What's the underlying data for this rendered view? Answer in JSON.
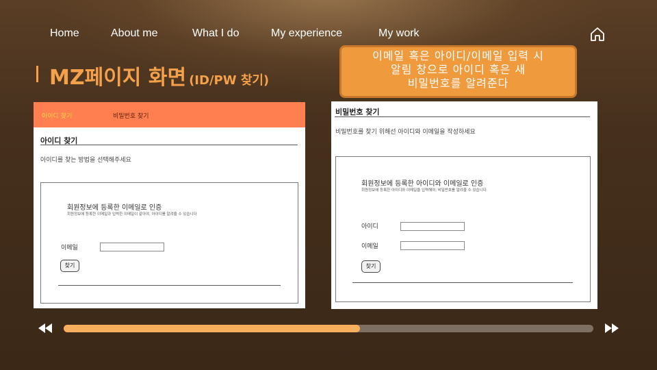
{
  "nav": {
    "items": [
      {
        "label": "Home"
      },
      {
        "label": "About me"
      },
      {
        "label": "What I do"
      },
      {
        "label": "My experience"
      },
      {
        "label": "My work"
      }
    ],
    "home_icon": "home-icon"
  },
  "title": {
    "main": "MZ페이지 화면",
    "sub": "(ID/PW 찾기)"
  },
  "callout": {
    "lines": [
      "이메일 혹은 아이디/이메일 입력 시",
      "알림 창으로 아이디 혹은 새",
      "비밀번호를 알려준다"
    ]
  },
  "find_id": {
    "tabs": [
      "아이디 찾기",
      "비밀번호 찾기"
    ],
    "section_title": "아이디 찾기",
    "description": "아이디를 찾는 방법을 선택해주세요",
    "box_title": "회원정보에 등록한 이메일로 인증",
    "box_desc": "회원정보에 등록한 이메일과 입력한 이메일이 같아야, 아이디를 알려줄 수 있습니다",
    "email_label": "이메일",
    "email_value": "",
    "button": "찾기"
  },
  "find_pw": {
    "section_title": "비밀번호 찾기",
    "description": "비밀번호를 찾기 위해선 아이디와 이메일을 작성하세요",
    "box_title": "회원정보에 등록한 아이디와 이메일로 인증",
    "box_desc": "회원정보에 등록한 아이디와 이메일을 입력해야, 비밀번호를 알려줄 수 있습니다",
    "id_label": "아이디",
    "id_value": "",
    "email_label": "이메일",
    "email_value": "",
    "button": "찾기"
  },
  "progress": {
    "fraction": 0.56,
    "prev_icon": "rewind-icon",
    "next_icon": "fast-forward-icon"
  },
  "colors": {
    "accent": "#f5a04a",
    "tabbar": "#ff7f50",
    "progress_fill": "#f7ae5d",
    "progress_track": "#7d6f62"
  }
}
